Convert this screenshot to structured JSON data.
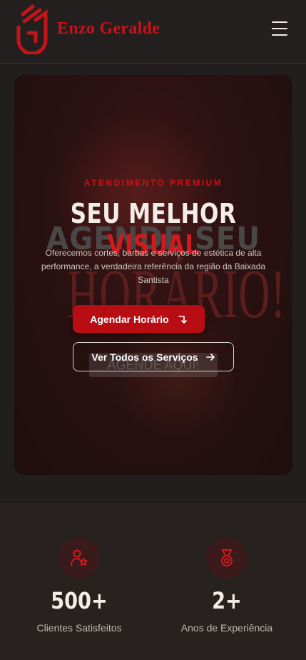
{
  "header": {
    "brand": "Enzo Geralde",
    "menu_icon": "hamburger-icon",
    "brand_color": "#c4141a"
  },
  "hero": {
    "eyebrow": "ATENDIMENTO PREMIUM",
    "title_main": "SEU MELHOR",
    "title_accent": "VISUAL",
    "description": "Oferecemos cortes, barbas e serviços de estética de alta performance, a verdadeira referência da região da Baixada Santista",
    "primary_button": "Agendar Horário",
    "primary_icon": "arrow-down-right-icon",
    "secondary_button": "Ver Todos os Serviços",
    "secondary_icon": "arrow-right-icon",
    "background_text": {
      "line1": "AGENDE SEU",
      "line2": "HORÁRIO!",
      "badge": "AGENDE AQUI!"
    },
    "accent_color": "#b80e13"
  },
  "stats": [
    {
      "value": "500+",
      "label": "Clientes Satisfeitos",
      "icon": "user-star-icon"
    },
    {
      "value": "2+",
      "label": "Anos de Experiência",
      "icon": "medal-icon"
    }
  ]
}
